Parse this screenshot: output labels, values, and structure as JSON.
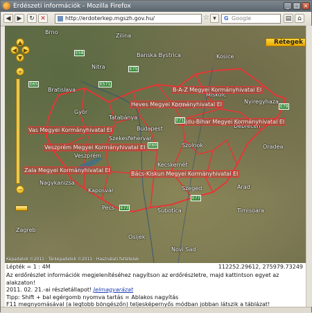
{
  "window": {
    "title": "Erdészeti információk - Mozilla Firefox"
  },
  "toolbar": {
    "back_icon": "back-arrow-icon",
    "forward_icon": "forward-arrow-icon",
    "reload_icon": "reload-icon",
    "stop_icon": "stop-icon",
    "home_icon": "home-icon",
    "url": "http://erdoterkep.mgszh.gov.hu/",
    "search_placeholder": "Google"
  },
  "map": {
    "layers_button": "Rétegek",
    "cities": [
      "Brno",
      "Zilina",
      "Nitra",
      "Bratislava",
      "Györ",
      "Tatabánya",
      "Budapest",
      "Szekesfehervar",
      "Veszprém",
      "Nagykanizsa",
      "Kaposvár",
      "Pecs",
      "Szeged",
      "Kecskemét",
      "Miskolc",
      "Debrecen",
      "Oradea",
      "Arad",
      "Timisoara",
      "Kosice",
      "Banska Bystrica",
      "Zagreb",
      "Osijek",
      "Novi Sad",
      "Subotica",
      "Szolnok",
      "Eger",
      "Nyiregyhaza"
    ],
    "offices": [
      "B-A-Z Megyei Kormányhivatal EI",
      "Heves Megyei Kormányhivatal EI",
      "Hajdu-Bihar Megyei Kormányhivatal EI",
      "Vas Megyei Kormányhivatal EI",
      "Veszprém Megyei Kormányhivatal EI",
      "Zala Megyei Kormányhivatal EI",
      "Bács-Kiskun Megyei Kormányhivatal EI"
    ],
    "roads": [
      "E58",
      "E75",
      "E571",
      "E65",
      "E60",
      "E71",
      "E79",
      "E73",
      "E77"
    ],
    "footnote": "Képadatok ©2011 · Térképadatok ©2011 · Használati feltételek"
  },
  "scale": {
    "label": "Lépték = 1 : 4M",
    "coords": "112252.29612, 275979.73249"
  },
  "info": {
    "line1": "Az erdőrészlet információk megjelenítéséhez nagyítson az erdőrészletre, majd kattintson egyet az alakzaton!",
    "line2_prefix": "2011. 02. 21.-ai részletállapot!",
    "line2_link": "Jelmagyarázat",
    "line3": "Tipp: Shift + bal egérgomb nyomva tartás = Ablakos nagyítás",
    "line4": "F11 megnyomásával (a legtobb böngészőn) teljesképernyős módban jobban látszik a táblázat!"
  }
}
